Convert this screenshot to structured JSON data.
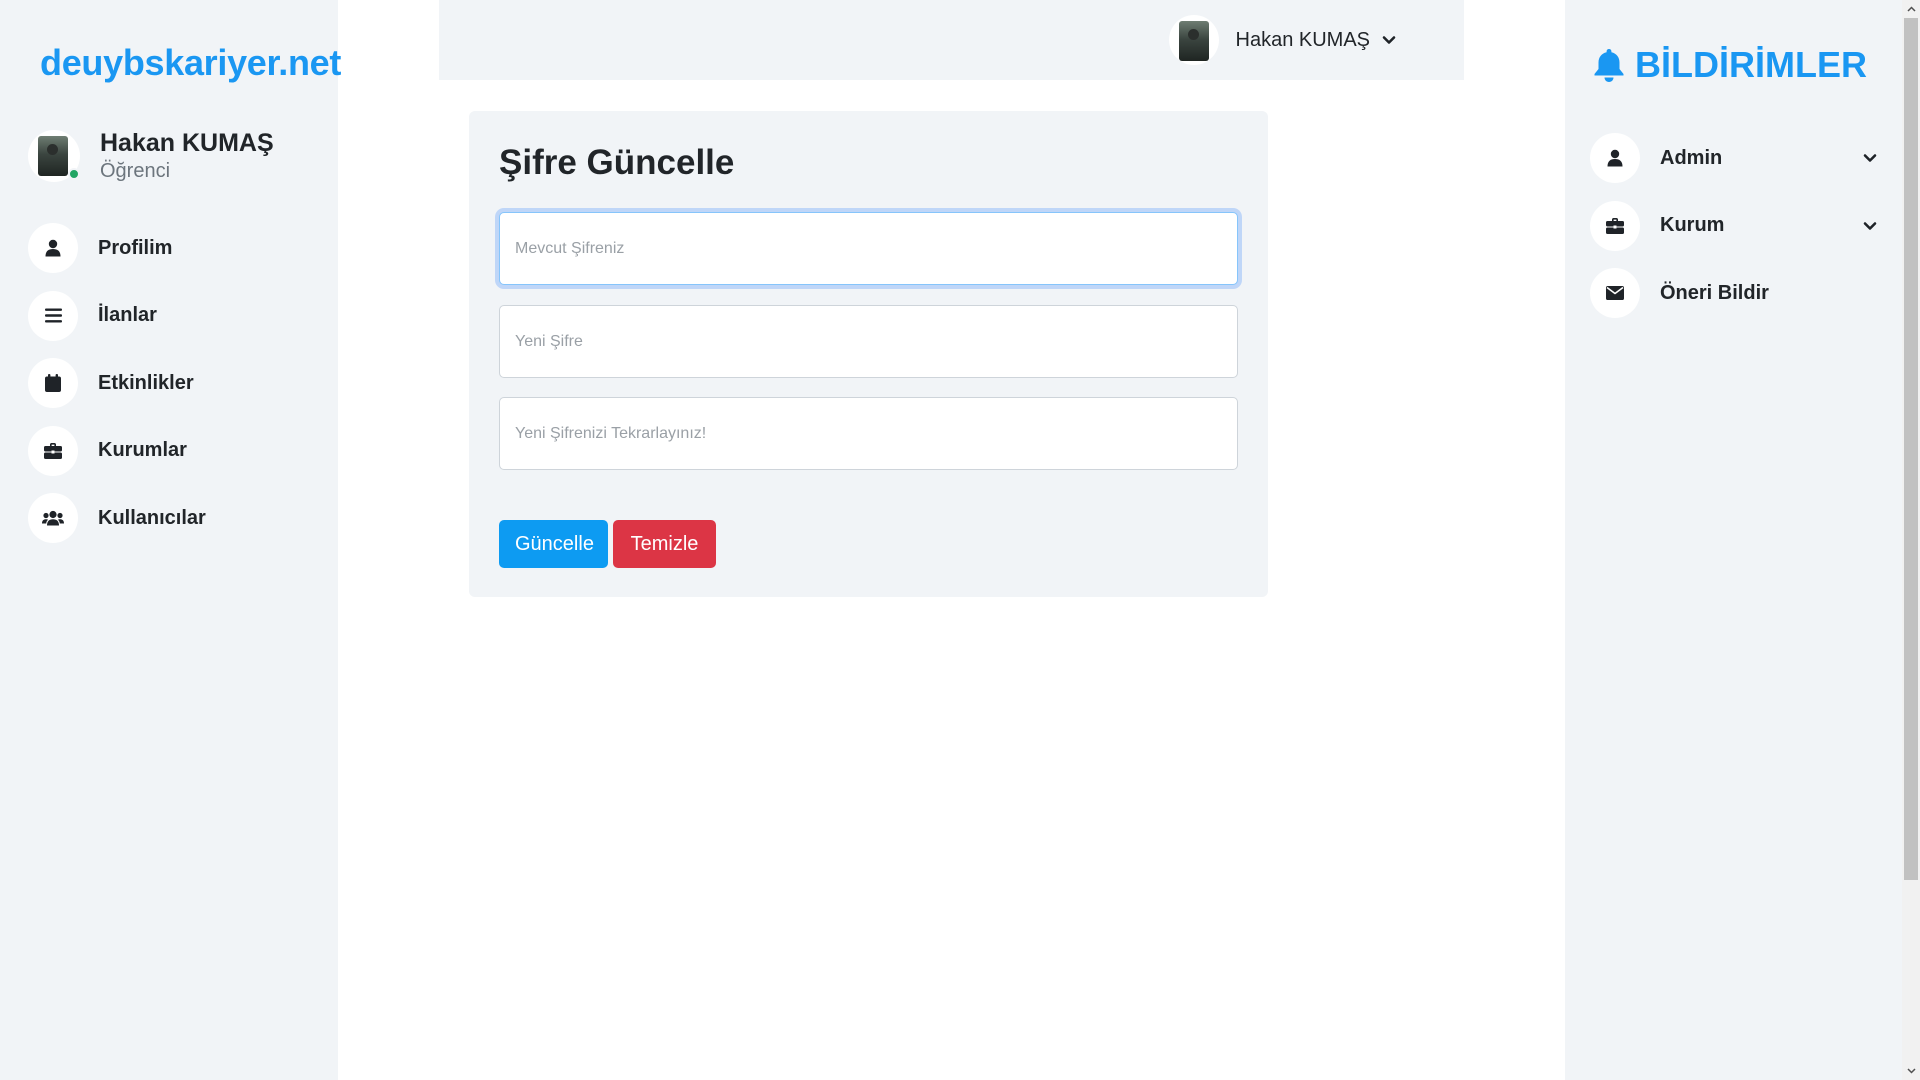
{
  "brand": "deuybskariyer.net",
  "profile": {
    "name": "Hakan KUMAŞ",
    "role": "Öğrenci"
  },
  "nav": [
    {
      "label": "Profilim",
      "icon": "user-icon"
    },
    {
      "label": "İlanlar",
      "icon": "list-icon"
    },
    {
      "label": "Etkinlikler",
      "icon": "calendar-icon"
    },
    {
      "label": "Kurumlar",
      "icon": "briefcase-icon"
    },
    {
      "label": "Kullanıcılar",
      "icon": "users-icon"
    }
  ],
  "topbar": {
    "user_name": "Hakan KUMAŞ"
  },
  "form": {
    "title": "Şifre Güncelle",
    "current_placeholder": "Mevcut Şifreniz",
    "new_placeholder": "Yeni Şifre",
    "repeat_placeholder": "Yeni Şifrenizi Tekrarlayınız!",
    "submit_label": "Güncelle",
    "clear_label": "Temizle"
  },
  "notifications": {
    "title": "BİLDİRİMLER",
    "items": [
      {
        "label": "Admin",
        "icon": "user-icon",
        "expandable": true
      },
      {
        "label": "Kurum",
        "icon": "briefcase-icon",
        "expandable": true
      },
      {
        "label": "Öneri Bildir",
        "icon": "envelope-icon",
        "expandable": false
      }
    ]
  },
  "colors": {
    "accent": "#1a97f2",
    "primary_button": "#0d9bf2",
    "danger_button": "#dc3545",
    "panel_bg": "#f1f4f7",
    "online": "#22a564"
  }
}
